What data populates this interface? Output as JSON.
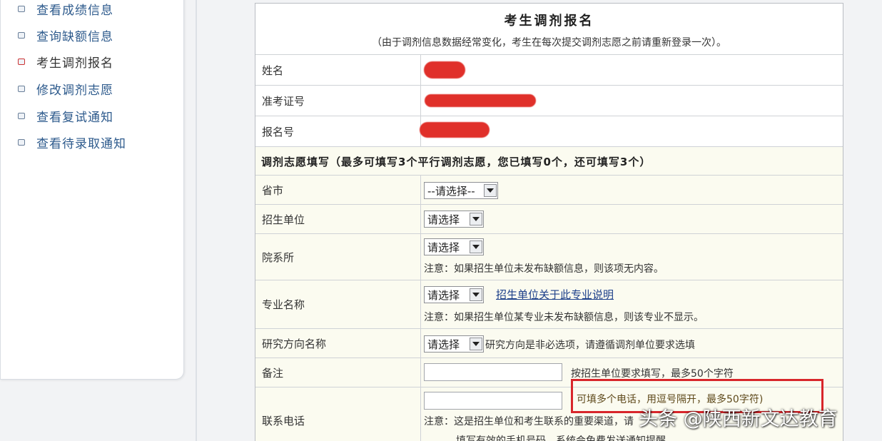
{
  "sidebar": {
    "items": [
      {
        "label": "查看成绩信息"
      },
      {
        "label": "查询缺额信息"
      },
      {
        "label": "考生调剂报名"
      },
      {
        "label": "修改调剂志愿"
      },
      {
        "label": "查看复试通知"
      },
      {
        "label": "查看待录取通知"
      }
    ]
  },
  "form": {
    "title": "考生调剂报名",
    "subtitle": "（由于调剂信息数据经常变化，考生在每次提交调剂志愿之前请重新登录一次）。",
    "fields": {
      "name_label": "姓名",
      "exam_id_label": "准考证号",
      "reg_no_label": "报名号"
    },
    "section_title": "调剂志愿填写（最多可填写3个平行调剂志愿，您已填写0个，还可填写3个）",
    "province": {
      "label": "省市",
      "value": "--请选择--"
    },
    "school": {
      "label": "招生单位",
      "value": "请选择"
    },
    "department": {
      "label": "院系所",
      "value": "请选择",
      "note": "注意：如果招生单位未发布缺额信息，则该项无内容。"
    },
    "major": {
      "label": "专业名称",
      "value": "请选择",
      "link": "招生单位关于此专业说明",
      "note": "注意：如果招生单位某专业未发布缺额信息，则该专业不显示。"
    },
    "research": {
      "label": "研究方向名称",
      "value": "请选择",
      "note": "研究方向是非必选项，请遵循调剂单位要求选填"
    },
    "remark": {
      "label": "备注",
      "hint": "按招生单位要求填写，最多50个字符"
    },
    "phone": {
      "label": "联系电话",
      "hint": "可填多个电话，用逗号隔开，最多50字符)",
      "note_line1": "注意：这是招生单位和考生联系的重要渠道，请",
      "note_line2": "填写有效的手机号码，系统会免费发送通知提醒。"
    }
  },
  "watermark": "头条 @陕西新文达教育",
  "colors": {
    "highlight_box": "#d8262b",
    "redaction": "#e0302a",
    "link": "#1c3f8a"
  }
}
